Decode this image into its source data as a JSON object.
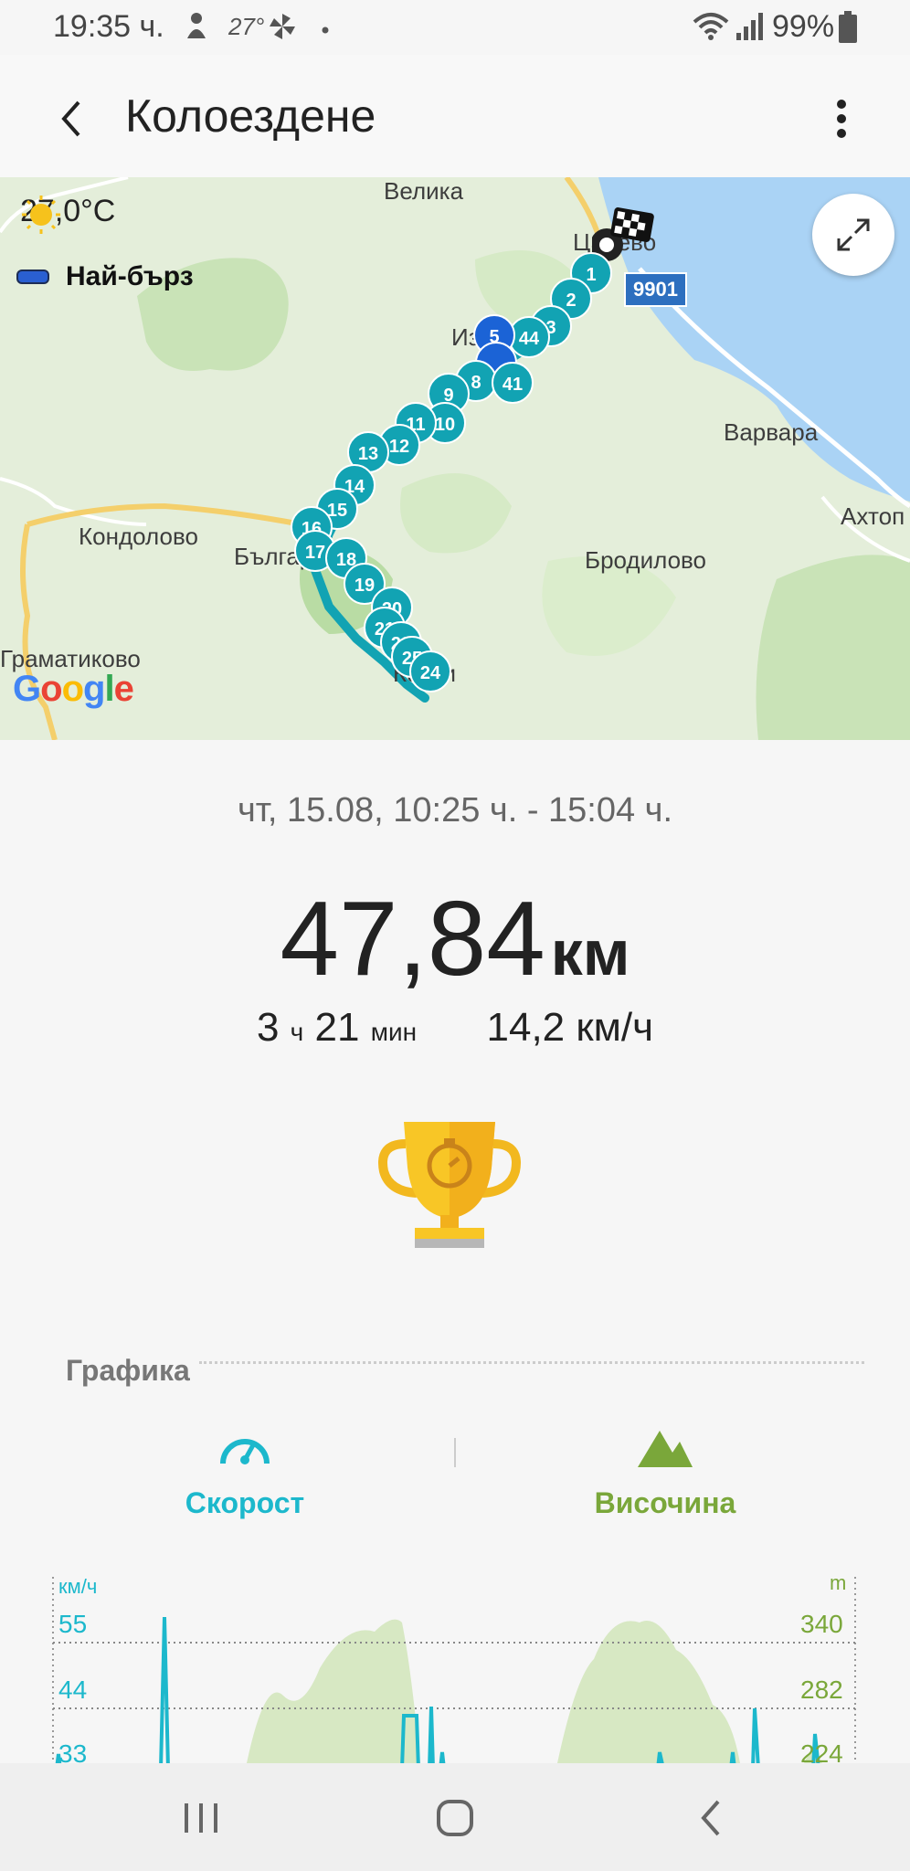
{
  "status_bar": {
    "time": "19:35 ч.",
    "weather_temp": "27°",
    "battery": "99%",
    "icons": [
      "notification-icon",
      "weather-icon",
      "fan-icon",
      "dot-icon",
      "wifi-icon",
      "signal-icon",
      "battery-icon"
    ]
  },
  "app_bar": {
    "title": "Колоездене",
    "back_icon": "back-arrow-icon",
    "menu_icon": "more-vert-icon"
  },
  "map": {
    "temperature": "27,0°C",
    "legend_label": "Най-бърз",
    "places": {
      "velika": "Велика",
      "tsarevo": "Царево",
      "varvara": "Варвара",
      "ahtopol": "Ахтоп",
      "kondolovo": "Кондолово",
      "brodilovo": "Бродилово",
      "balgari": "Българи",
      "gramatikovo": "Граматиково",
      "kosti": "Кости",
      "izgrev": "Из"
    },
    "road_number": "9901",
    "google_logo": "Google",
    "markers": [
      "1",
      "2",
      "3",
      "44",
      "5",
      "8",
      "41",
      "9",
      "10",
      "11",
      "12",
      "13",
      "14",
      "15",
      "16",
      "17",
      "18",
      "19",
      "20",
      "21",
      "22",
      "25",
      "24"
    ],
    "expand_icon": "expand-icon",
    "finish_icon": "checkered-flag-icon",
    "colors": {
      "route": "#12a3b3",
      "fastest": "#1b63d6"
    }
  },
  "summary": {
    "datetime": "чт, 15.08, 10:25 ч. - 15:04 ч.",
    "distance_value": "47,84",
    "distance_unit": "км",
    "duration_hours": "3",
    "duration_hours_unit": "ч",
    "duration_minutes": "21",
    "duration_minutes_unit": "мин",
    "avg_speed": "14,2 км/ч",
    "trophy_icon": "trophy-stopwatch-icon"
  },
  "graphs": {
    "title": "Графика",
    "tabs": [
      {
        "label": "Скорост",
        "icon": "speedometer-icon",
        "color": "#1cb8cc"
      },
      {
        "label": "Височина",
        "icon": "mountain-icon",
        "color": "#7aa73a"
      }
    ],
    "chart": {
      "left_unit": "км/ч",
      "right_unit": "m",
      "left_ticks": [
        "55",
        "44",
        "33"
      ],
      "right_ticks": [
        "340",
        "282",
        "224"
      ]
    }
  },
  "nav_bar": {
    "recents_icon": "recents-icon",
    "home_icon": "home-icon",
    "back_icon": "nav-back-icon"
  }
}
